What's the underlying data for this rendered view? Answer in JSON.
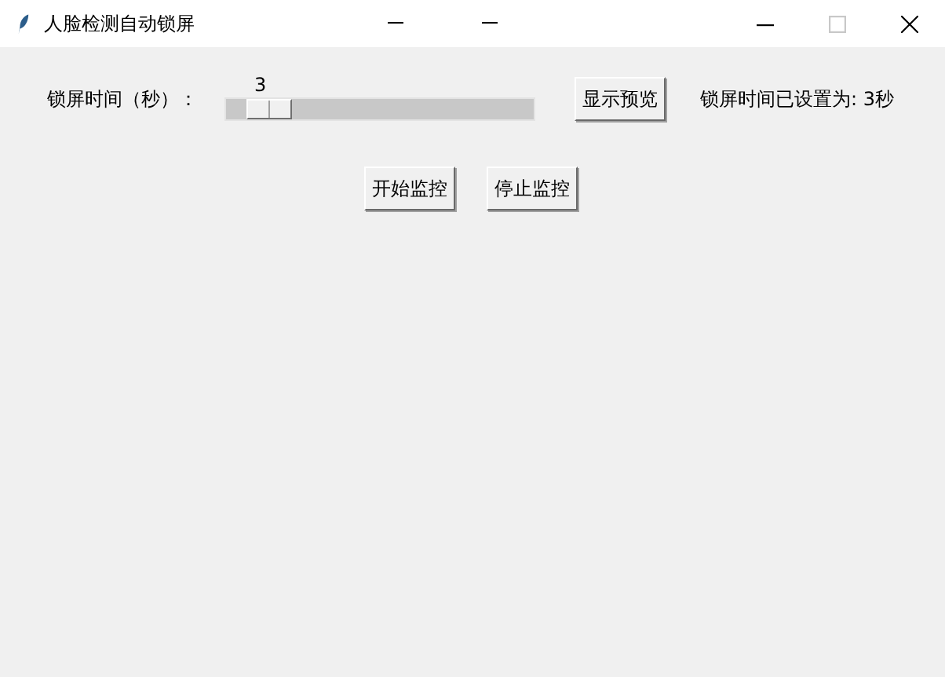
{
  "window": {
    "title": "人脸检测自动锁屏",
    "maximize_disabled": true
  },
  "lock_time": {
    "label": "锁屏时间（秒）：",
    "value": "3",
    "level": 0.04
  },
  "preview_button": "显示预览",
  "status": "锁屏时间已设置为: 3秒",
  "buttons": [
    "开始监控",
    "停止监控"
  ]
}
